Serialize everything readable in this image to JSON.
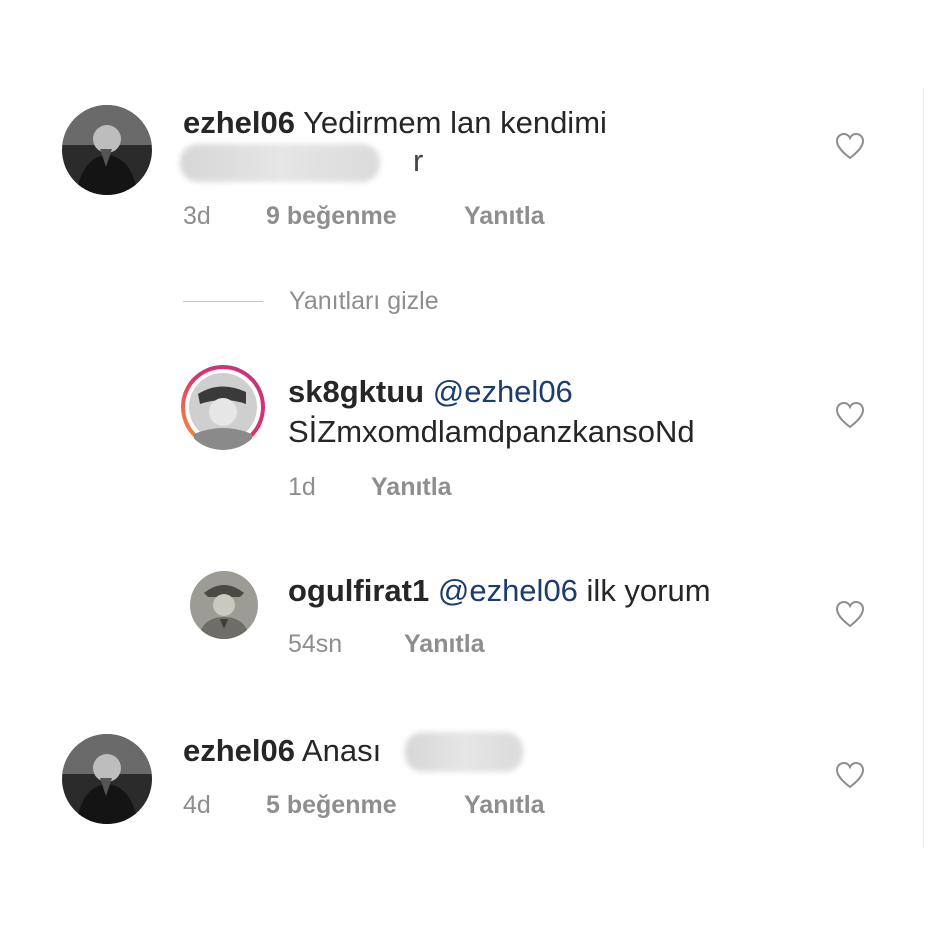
{
  "comments": [
    {
      "username": "ezhel06",
      "text": "Yedirmem lan kendimi",
      "text_line2_tail": "r",
      "time": "3d",
      "likes": "9 beğenme",
      "reply": "Yanıtla"
    },
    {
      "username": "ezhel06",
      "text": "Anası",
      "time": "4d",
      "likes": "5 beğenme",
      "reply": "Yanıtla"
    }
  ],
  "hide_replies_label": "Yanıtları gizle",
  "replies": [
    {
      "username": "sk8gktuu",
      "mention": "@ezhel06",
      "text": "SİZmxomdlamdpanzkansoNd",
      "time": "1d",
      "reply": "Yanıtla"
    },
    {
      "username": "ogulfirat1",
      "mention": "@ezhel06",
      "text": "ilk yorum",
      "time": "54sn",
      "reply": "Yanıtla"
    }
  ],
  "colors": {
    "username": "#262626",
    "mention": "#1a3d6e",
    "meta": "#8e8e8e",
    "story_ring_start": "#f7a234",
    "story_ring_end": "#c13584"
  },
  "icons": {
    "like": "heart-outline-icon"
  }
}
